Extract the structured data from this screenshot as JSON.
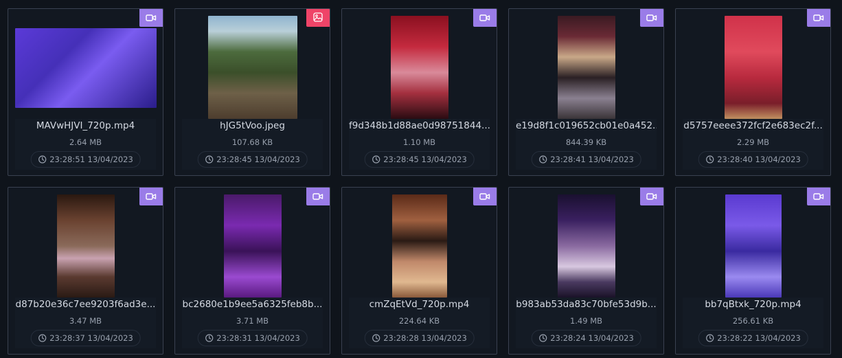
{
  "colors": {
    "background": "#0f141b",
    "card_border": "#3a4150",
    "video_badge": "#9a7ce8",
    "image_badge": "#ef4468"
  },
  "items": [
    {
      "name": "MAVwHJVI_720p.mp4",
      "size": "2.64 MB",
      "time": "23:28:51 13/04/2023",
      "type": "video",
      "badge_icon": "video-camera-icon"
    },
    {
      "name": "hJG5tVoo.jpeg",
      "size": "107.68 KB",
      "time": "23:28:45 13/04/2023",
      "type": "image",
      "badge_icon": "image-icon"
    },
    {
      "name": "f9d348b1d88ae0d98751844...",
      "size": "1.10 MB",
      "time": "23:28:45 13/04/2023",
      "type": "video",
      "badge_icon": "video-camera-icon"
    },
    {
      "name": "e19d8f1c019652cb01e0a452...",
      "size": "844.39 KB",
      "time": "23:28:41 13/04/2023",
      "type": "video",
      "badge_icon": "video-camera-icon"
    },
    {
      "name": "d5757eeee372fcf2e683ec2f...",
      "size": "2.29 MB",
      "time": "23:28:40 13/04/2023",
      "type": "video",
      "badge_icon": "video-camera-icon"
    },
    {
      "name": "d87b20e36c7ee9203f6ad3e...",
      "size": "3.47 MB",
      "time": "23:28:37 13/04/2023",
      "type": "video",
      "badge_icon": "video-camera-icon"
    },
    {
      "name": "bc2680e1b9ee5a6325feb8b...",
      "size": "3.71 MB",
      "time": "23:28:31 13/04/2023",
      "type": "video",
      "badge_icon": "video-camera-icon"
    },
    {
      "name": "cmZqEtVd_720p.mp4",
      "size": "224.64 KB",
      "time": "23:28:28 13/04/2023",
      "type": "video",
      "badge_icon": "video-camera-icon"
    },
    {
      "name": "b983ab53da83c70bfe53d9b...",
      "size": "1.49 MB",
      "time": "23:28:24 13/04/2023",
      "type": "video",
      "badge_icon": "video-camera-icon"
    },
    {
      "name": "bb7qBtxk_720p.mp4",
      "size": "256.61 KB",
      "time": "23:28:22 13/04/2023",
      "type": "video",
      "badge_icon": "video-camera-icon"
    }
  ]
}
